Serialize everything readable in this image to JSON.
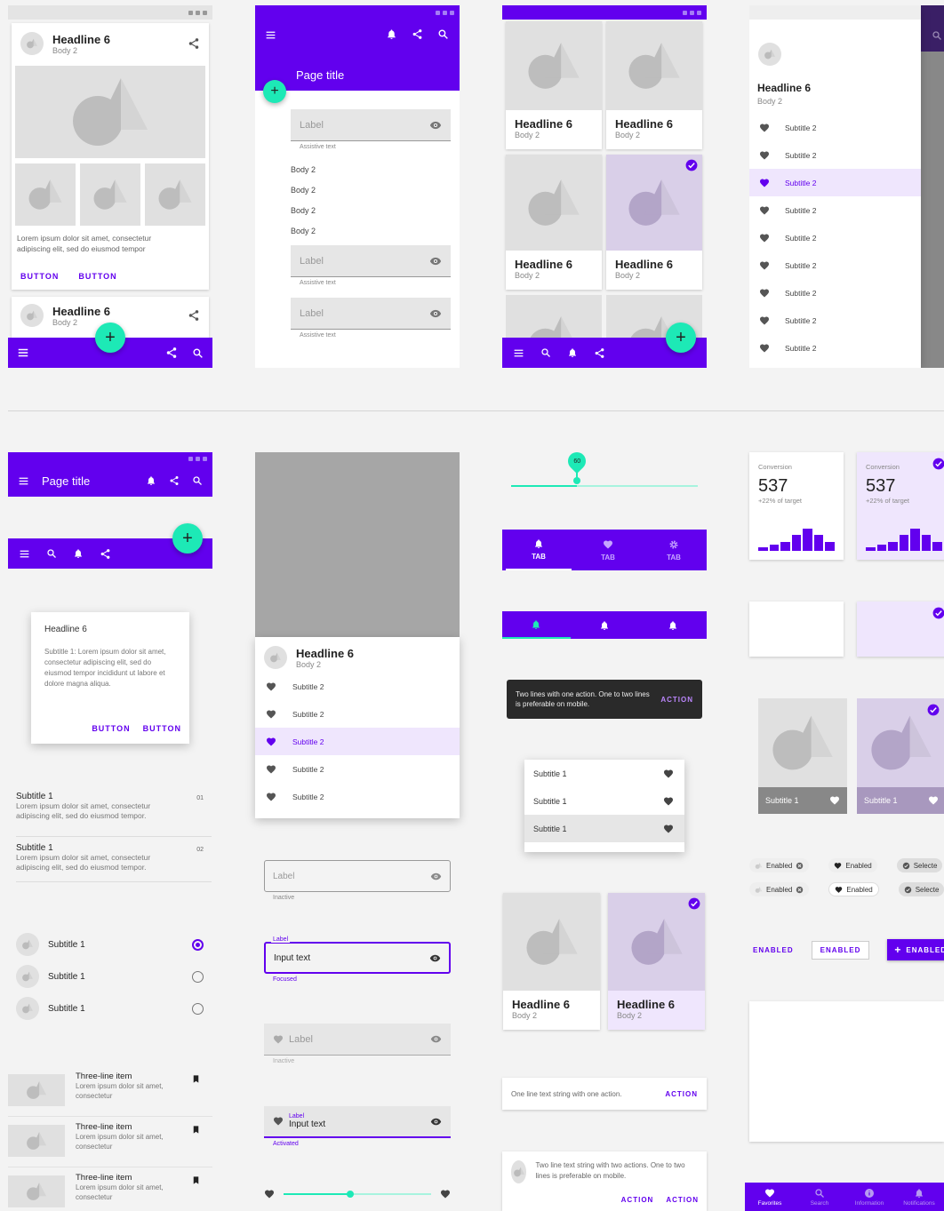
{
  "common": {
    "headline": "Headline 6",
    "body2": "Body 2",
    "subtitle1": "Subtitle 1",
    "subtitle2": "Subtitle 2",
    "button": "BUTTON",
    "action": "ACTION",
    "label": "Label",
    "assistive": "Assistive text",
    "page_title": "Page title",
    "tab": "TAB",
    "enabled_upper": "ENABLED",
    "enabled": "Enabled",
    "selected": "Selecte",
    "plus": "+",
    "lorem_short": "Lorem ipsum dolor sit amet, consectetur adipiscing elit, sed do eiusmod tempor",
    "lorem_list": "Lorem ipsum dolor sit amet, consectetur adipiscing elit, sed do eiusmod tempor.",
    "three_line": "Three-line item",
    "three_line_body": "Lorem ipsum dolor sit amet, consectetur"
  },
  "dialog": {
    "title": "Headline 6",
    "text": "Subtitle 1: Lorem ipsum dolor sit amet, consectetur adipiscing elit, sed do eiusmod tempor incididunt ut labore et dolore magna aliqua."
  },
  "list_numbers": [
    "01",
    "02"
  ],
  "fields": {
    "inactive": "Inactive",
    "focused": "Focused",
    "activated": "Activated",
    "input_text": "Input text"
  },
  "slider": {
    "value": "60",
    "position": 0.35
  },
  "snackbar": {
    "text": "Two lines with one action. One to two lines is preferable on mobile.",
    "action": "ACTION"
  },
  "banner_one": {
    "text": "One line text string with one action.",
    "action": "ACTION"
  },
  "banner_two": {
    "text": "Two line text string with two actions. One to two lines is preferable on mobile.",
    "action1": "ACTION",
    "action2": "ACTION"
  },
  "stats": {
    "label": "Conversion",
    "value": "537",
    "delta": "+22% of target",
    "bars": [
      0.15,
      0.25,
      0.35,
      0.6,
      0.85,
      0.6,
      0.35
    ]
  },
  "bottom_nav": [
    "Favorites",
    "Search",
    "Information",
    "Notifications"
  ],
  "colors": {
    "primary": "#6200ee",
    "secondary": "#1de9b6",
    "selected_bg": "#efe6fd"
  }
}
